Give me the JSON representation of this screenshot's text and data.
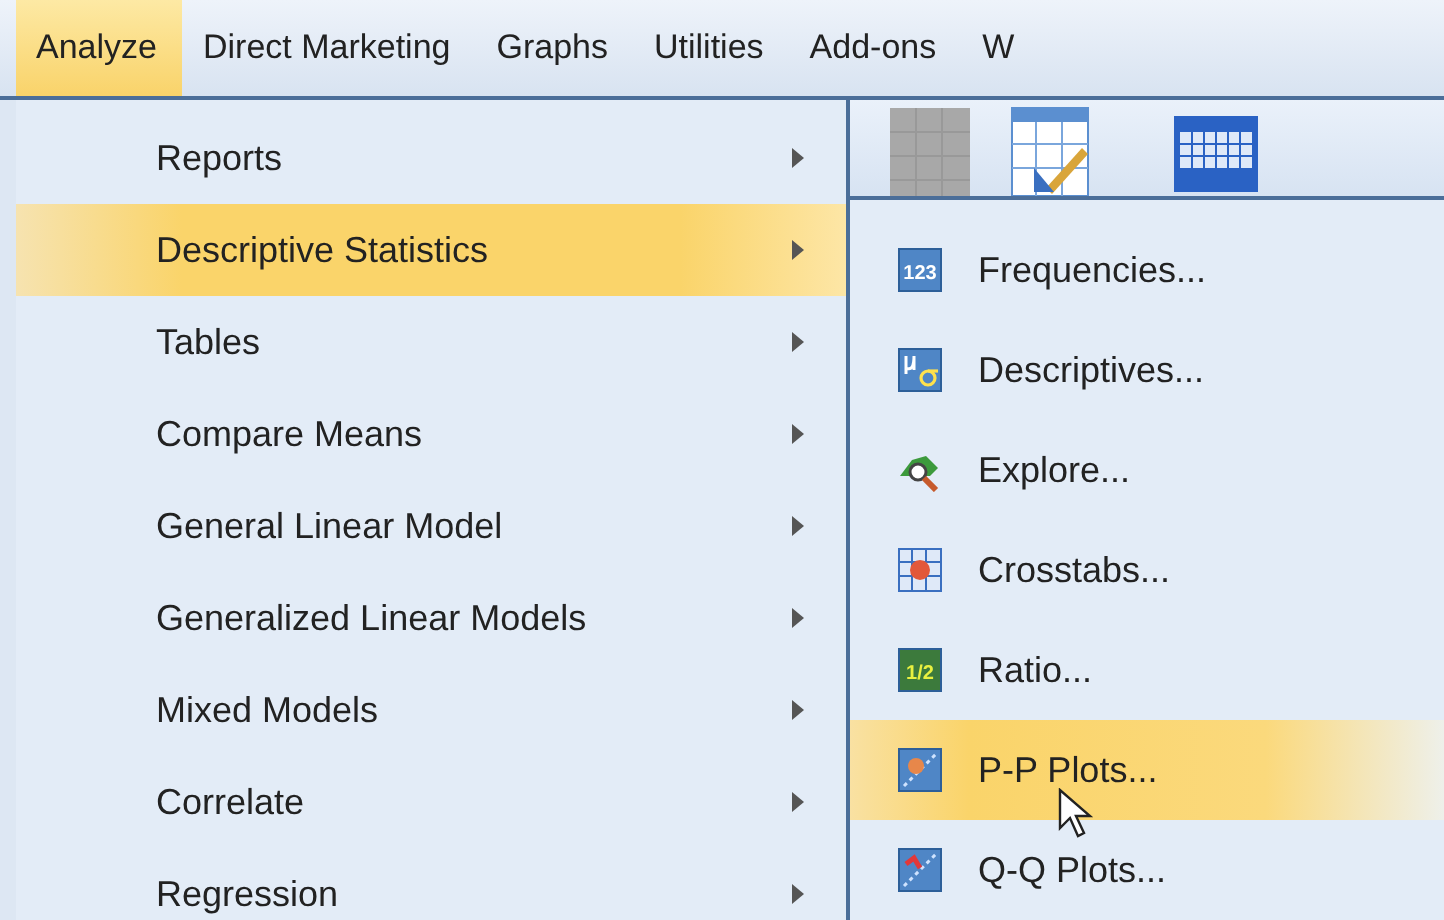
{
  "menubar": [
    {
      "label": "Analyze",
      "selected": true
    },
    {
      "label": "Direct Marketing",
      "selected": false
    },
    {
      "label": "Graphs",
      "selected": false
    },
    {
      "label": "Utilities",
      "selected": false
    },
    {
      "label": "Add-ons",
      "selected": false
    },
    {
      "label": "W",
      "selected": false
    }
  ],
  "toolbar": [
    {
      "kind": "blank"
    },
    {
      "kind": "edit-table"
    },
    {
      "kind": "grid"
    }
  ],
  "menu": [
    {
      "label": "Reports",
      "selected": false,
      "has_submenu": true
    },
    {
      "label": "Descriptive Statistics",
      "selected": true,
      "has_submenu": true
    },
    {
      "label": "Tables",
      "selected": false,
      "has_submenu": true
    },
    {
      "label": "Compare Means",
      "selected": false,
      "has_submenu": true
    },
    {
      "label": "General Linear Model",
      "selected": false,
      "has_submenu": true
    },
    {
      "label": "Generalized Linear Models",
      "selected": false,
      "has_submenu": true
    },
    {
      "label": "Mixed Models",
      "selected": false,
      "has_submenu": true
    },
    {
      "label": "Correlate",
      "selected": false,
      "has_submenu": true
    },
    {
      "label": "Regression",
      "selected": false,
      "has_submenu": true
    }
  ],
  "submenu": [
    {
      "label": "Frequencies...",
      "kind": "numbers",
      "icon_text": "123",
      "selected": false
    },
    {
      "label": "Descriptives...",
      "kind": "mu-sigma",
      "selected": false
    },
    {
      "label": "Explore...",
      "kind": "explore",
      "selected": false
    },
    {
      "label": "Crosstabs...",
      "kind": "crosstab",
      "selected": false
    },
    {
      "label": "Ratio...",
      "kind": "ratio",
      "icon_text": "1/2",
      "selected": false
    },
    {
      "label": "P-P Plots...",
      "kind": "pp",
      "selected": true
    },
    {
      "label": "Q-Q Plots...",
      "kind": "qq",
      "selected": false
    }
  ]
}
